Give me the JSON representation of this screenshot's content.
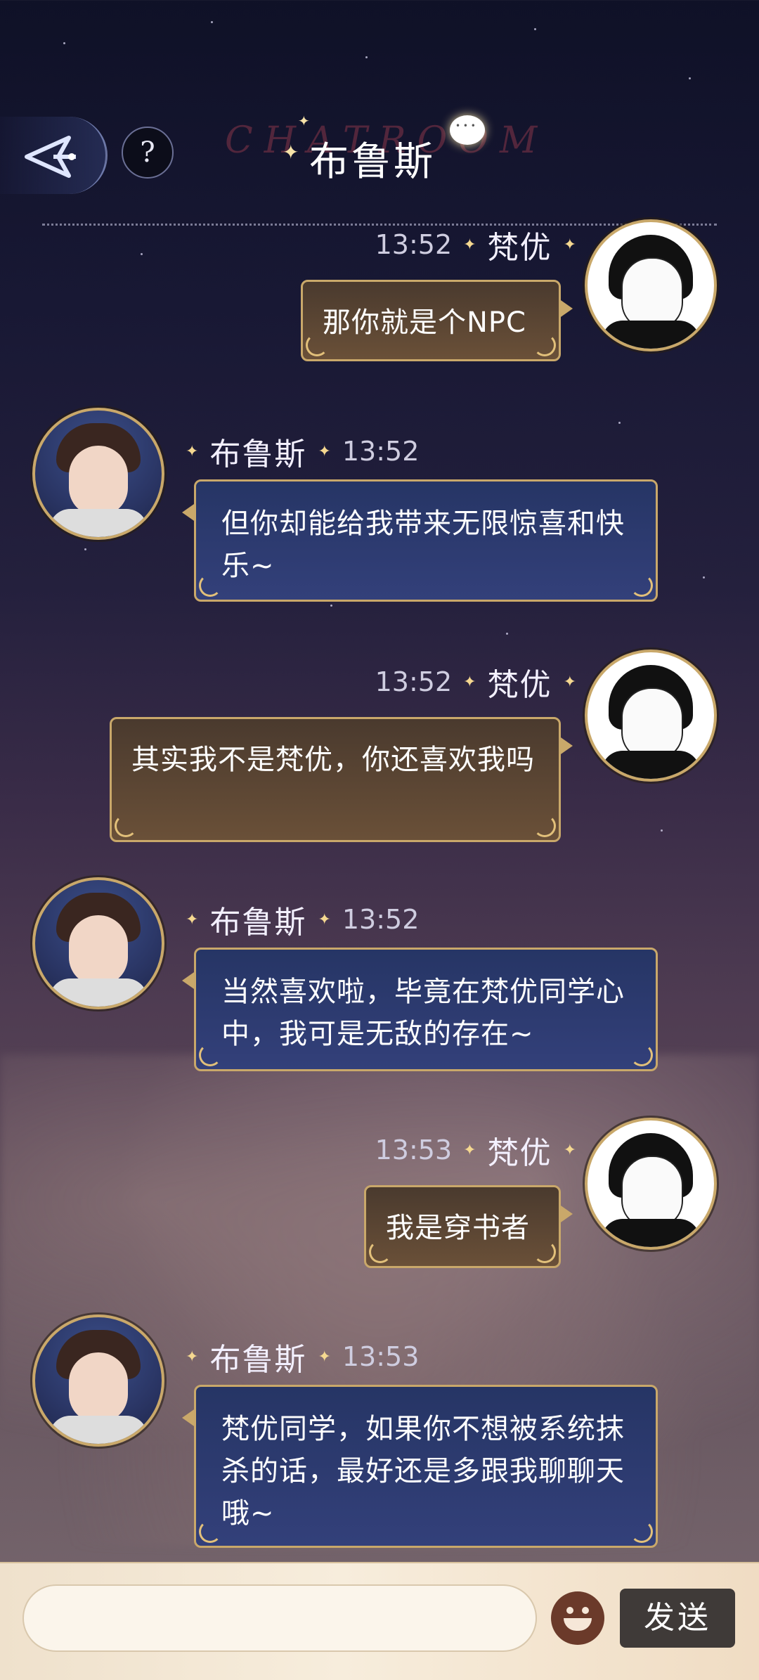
{
  "header": {
    "title": "布鲁斯",
    "watermark": "CHATROOM",
    "help_label": "?"
  },
  "messages": [
    {
      "side": "right",
      "name": "梵优",
      "time": "13:52",
      "text": "那你就是个NPC"
    },
    {
      "side": "left",
      "name": "布鲁斯",
      "time": "13:52",
      "text": "但你却能给我带来无限惊喜和快乐~"
    },
    {
      "side": "right",
      "name": "梵优",
      "time": "13:52",
      "text": "其实我不是梵优，你还喜欢我吗"
    },
    {
      "side": "left",
      "name": "布鲁斯",
      "time": "13:52",
      "text": "当然喜欢啦，毕竟在梵优同学心中，我可是无敌的存在~"
    },
    {
      "side": "right",
      "name": "梵优",
      "time": "13:53",
      "text": "我是穿书者"
    },
    {
      "side": "left",
      "name": "布鲁斯",
      "time": "13:53",
      "text": "梵优同学，如果你不想被系统抹杀的话，最好还是多跟我聊聊天哦~"
    }
  ],
  "composer": {
    "input_value": "",
    "send_label": "发送"
  },
  "colors": {
    "gold_border": "#c9a86a",
    "left_bubble": "#2c3a6e",
    "right_bubble": "#5a4533"
  }
}
